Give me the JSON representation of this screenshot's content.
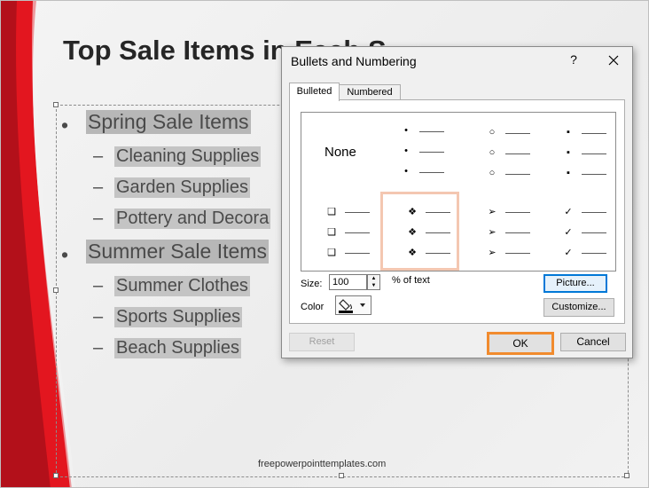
{
  "slide": {
    "title": "Top Sale Items in Each S",
    "footer": "freepowerpointtemplates.com",
    "bullets": [
      {
        "level": 1,
        "text": "Spring Sale Items"
      },
      {
        "level": 2,
        "text": "Cleaning Supplies"
      },
      {
        "level": 2,
        "text": "Garden Supplies"
      },
      {
        "level": 2,
        "text": "Pottery and Decora"
      },
      {
        "level": 1,
        "text": "Summer Sale Items"
      },
      {
        "level": 2,
        "text": "Summer Clothes"
      },
      {
        "level": 2,
        "text": "Sports Supplies"
      },
      {
        "level": 2,
        "text": "Beach Supplies"
      }
    ],
    "bullet_glyph": "•",
    "dash_glyph": "–"
  },
  "dialog": {
    "title": "Bullets and Numbering",
    "help": "?",
    "tabs": {
      "bulleted": "Bulleted",
      "numbered": "Numbered"
    },
    "grid": {
      "none_label": "None",
      "selected_style": "star-diamond",
      "styles": [
        {
          "name": "none"
        },
        {
          "name": "small-dot",
          "glyph": "•"
        },
        {
          "name": "hollow-circle",
          "glyph": "○"
        },
        {
          "name": "square",
          "glyph": "▪"
        },
        {
          "name": "hollow-square",
          "glyph": "❑"
        },
        {
          "name": "star-diamond",
          "glyph": "❖"
        },
        {
          "name": "arrow",
          "glyph": "➢"
        },
        {
          "name": "check",
          "glyph": "✓"
        }
      ]
    },
    "size_label": "Size:",
    "size_value": "100",
    "pct_label": "% of text",
    "color_label": "Color",
    "picture_button": "Picture...",
    "customize_button": "Customize...",
    "reset_button": "Reset",
    "ok_button": "OK",
    "cancel_button": "Cancel"
  },
  "colors": {
    "accent_red": "#d8121e",
    "selection_highlight": "#f4c7b1",
    "ok_highlight": "#f18b2e",
    "focus_blue": "#0078d7"
  }
}
